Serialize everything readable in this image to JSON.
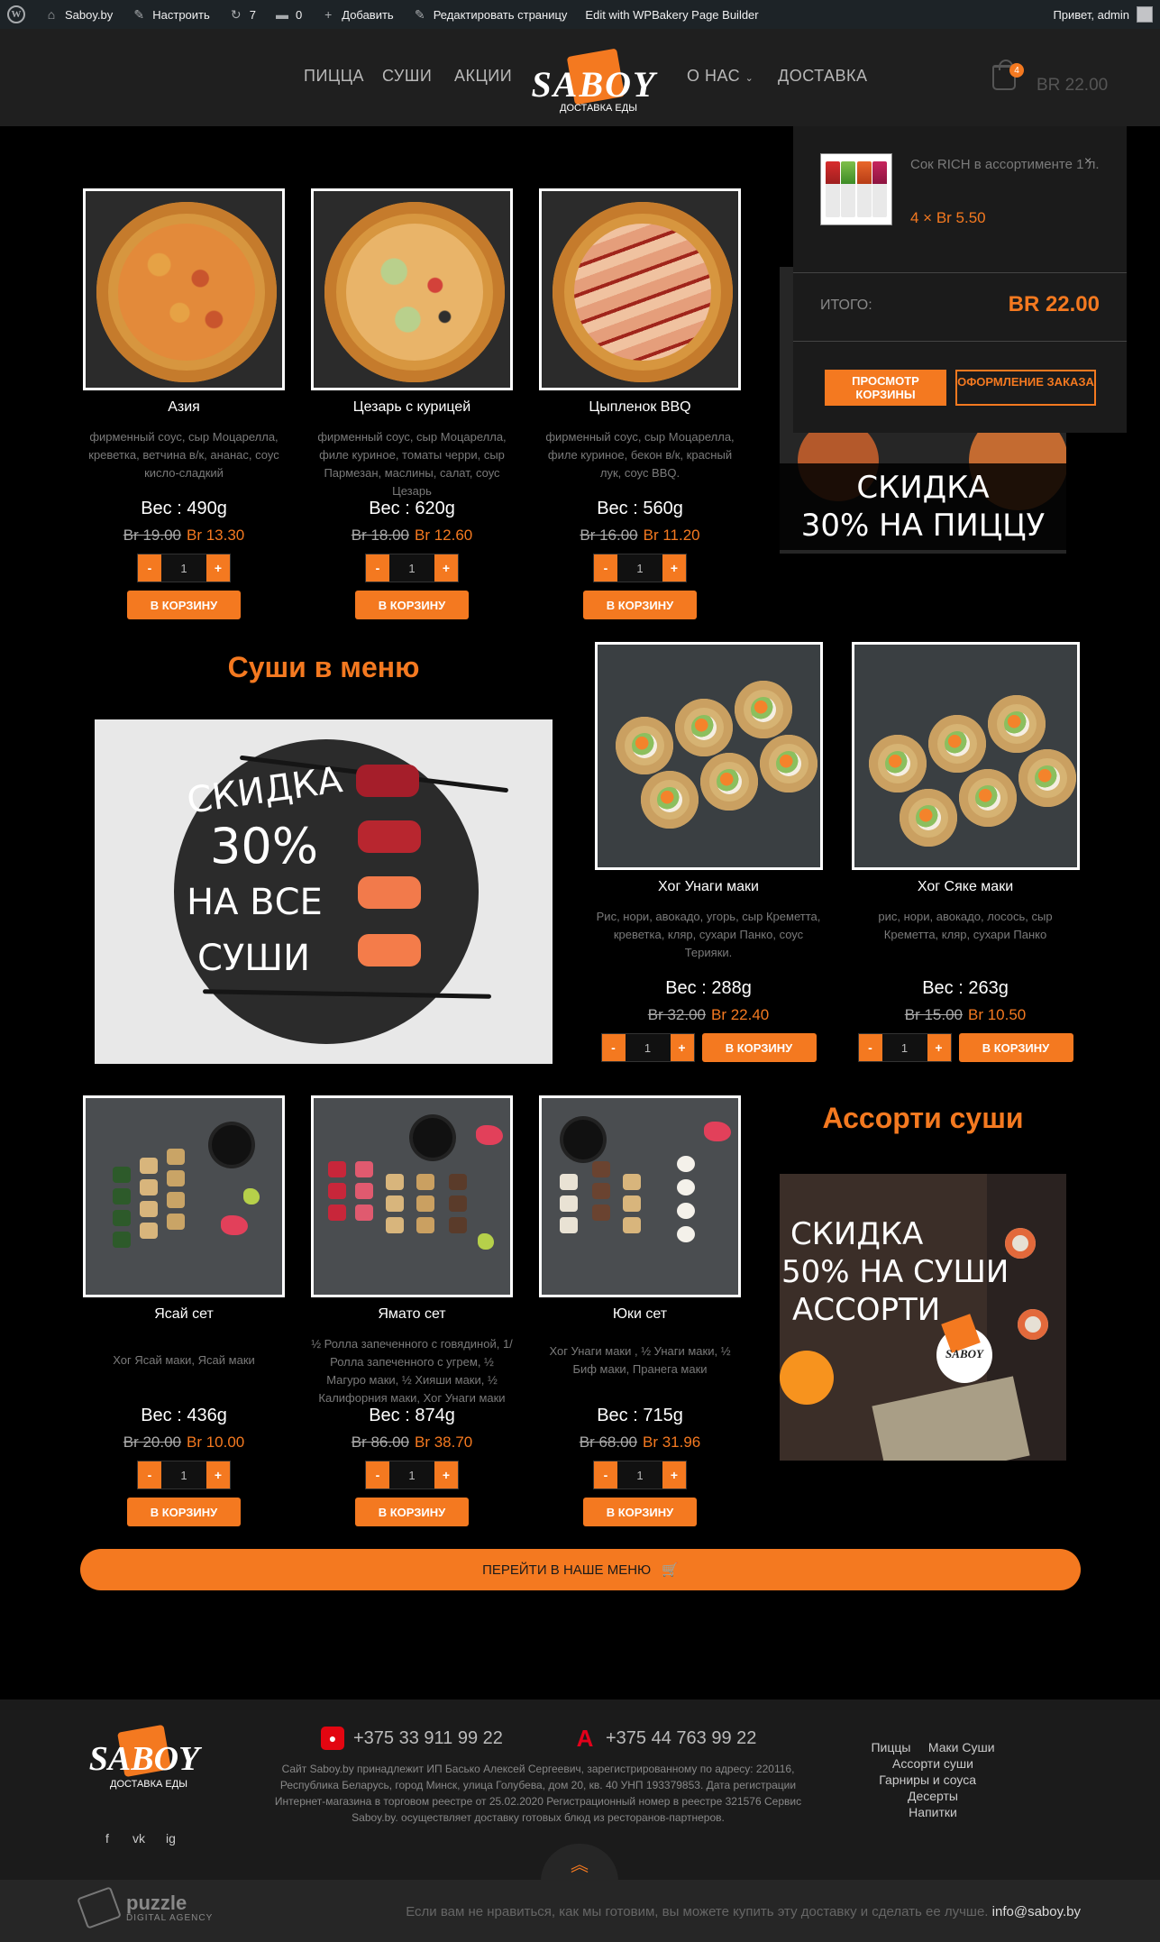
{
  "adminbar": {
    "site": "Saboy.by",
    "customize": "Настроить",
    "updates": "7",
    "comments": "0",
    "add": "Добавить",
    "edit": "Редактировать страницу",
    "builder": "Edit with WPBakery Page Builder",
    "greeting": "Привет, admin"
  },
  "nav": {
    "items": [
      "ПИЦЦА",
      "СУШИ",
      "АКЦИИ",
      "О НАС",
      "ДОСТАВКА"
    ],
    "logo_word": "SABOY",
    "logo_sub": "ДОСТАВКА ЕДЫ",
    "cart_count": "4",
    "cart_total": "BR 22.00"
  },
  "cart_dropdown": {
    "item_name": "Сок RICH в ассортименте 1 л.",
    "item_qty": "4 × Br 5.50",
    "total_label": "ИТОГО:",
    "total": "BR 22.00",
    "view_cart": "ПРОСМОТР КОРЗИНЫ",
    "checkout": "ОФОРМЛЕНИЕ ЗАКАЗА",
    "remove": "×"
  },
  "pizzas": [
    {
      "name": "Азия",
      "desc": "фирменный соус, сыр Моцарелла, креветка, ветчина в/к, ананас, соус кисло-сладкий",
      "weight": "Вес : 490g",
      "old": "Br 19.00",
      "new": "Br 13.30",
      "qty": "1",
      "btn": "В КОРЗИНУ"
    },
    {
      "name": "Цезарь с курицей",
      "desc": "фирменный соус, сыр Моцарелла, филе куриное, томаты черри, сыр Пармезан, маслины, салат, соус Цезарь",
      "weight": "Вес : 620g",
      "old": "Br 18.00",
      "new": "Br 12.60",
      "qty": "1",
      "btn": "В КОРЗИНУ"
    },
    {
      "name": "Цыпленок BBQ",
      "desc": "фирменный соус, сыр Моцарелла, филе куриное, бекон в/к, красный лук, соус BBQ.",
      "weight": "Вес : 560g",
      "old": "Br 16.00",
      "new": "Br 11.20",
      "qty": "1",
      "btn": "В КОРЗИНУ"
    }
  ],
  "promo_pizza": {
    "line1": "СКИДКА",
    "line2": "30% НА ПИЦЦУ"
  },
  "sushi_title": "Суши в меню",
  "promo_sushi": {
    "l1": "СКИДКА",
    "l2": "30%",
    "l3": "НА ВСЕ",
    "l4": "СУШИ"
  },
  "sushi": [
    {
      "name": "Хог Унаги маки",
      "desc": "Рис, нори, авокадо, угорь, сыр Креметта, креветка, кляр, сухари Панко, соус Терияки.",
      "weight": "Вес : 288g",
      "old": "Br 32.00",
      "new": "Br 22.40",
      "qty": "1",
      "btn": "В КОРЗИНУ"
    },
    {
      "name": "Хог Сяке маки",
      "desc": "рис, нори, авокадо, лосось, сыр Креметта, кляр, сухари Панко",
      "weight": "Вес : 263g",
      "old": "Br 15.00",
      "new": "Br 10.50",
      "qty": "1",
      "btn": "В КОРЗИНУ"
    }
  ],
  "sets": [
    {
      "name": "Ясай сет",
      "desc": "Хог Ясай маки, Ясай маки",
      "weight": "Вес : 436g",
      "old": "Br 20.00",
      "new": "Br 10.00",
      "qty": "1",
      "btn": "В КОРЗИНУ"
    },
    {
      "name": "Ямато сет",
      "desc": "½ Ролла запеченного с говядиной, 1/ Ролла запеченного с угрем, ½ Магуро маки, ½ Хияши маки, ½ Калифорния маки, Хог Унаги маки",
      "weight": "Вес : 874g",
      "old": "Br 86.00",
      "new": "Br 38.70",
      "qty": "1",
      "btn": "В КОРЗИНУ"
    },
    {
      "name": "Юки сет",
      "desc": "Хог Унаги маки , ½ Унаги маки, ½ Биф маки, Пранега маки",
      "weight": "Вес : 715g",
      "old": "Br 68.00",
      "new": "Br 31.96",
      "qty": "1",
      "btn": "В КОРЗИНУ"
    }
  ],
  "assorti_title": "Ассорти суши",
  "promo_assorti": {
    "l1": "СКИДКА",
    "l2": "50% НА СУШИ",
    "l3": "АССОРТИ",
    "logo": "SABOY"
  },
  "menu_button": "ПЕРЕЙТИ В НАШЕ МЕНЮ",
  "footer": {
    "phone1": "+375 33 911 99 22",
    "phone2": "+375 44 763 99 22",
    "text": "Сайт Saboy.by принадлежит ИП Басько Алексей Сергеевич, зарегистрированному по адресу: 220116, Республика Беларусь, город Минск, улица Голубева, дом 20, кв. 40 УНП 193379853. Дата регистрации Интернет-магазина в торговом реестре от 25.02.2020 Регистрационный номер в реестре 321576 Сервис Saboy.by. осуществляет доставку готовых блюд из ресторанов-партнеров.",
    "links": [
      "Пиццы",
      "Маки Суши",
      "Ассорти суши",
      "Гарниры и соуса",
      "Десерты",
      "Напитки"
    ],
    "social": [
      "f",
      "vk",
      "ig"
    ],
    "logo_word": "SABOY",
    "logo_sub": "ДОСТАВКА ЕДЫ"
  },
  "bottom": {
    "agency": "puzzle",
    "agency_sub": "DIGITAL AGENCY",
    "slogan": "Если вам не нравиться, как мы готовим, вы можете купить эту доставку и сделать ее лучше.",
    "email": "info@saboy.by"
  },
  "colors": {
    "accent": "#f47920",
    "background": "#000000",
    "panel": "#1f1f1f"
  }
}
